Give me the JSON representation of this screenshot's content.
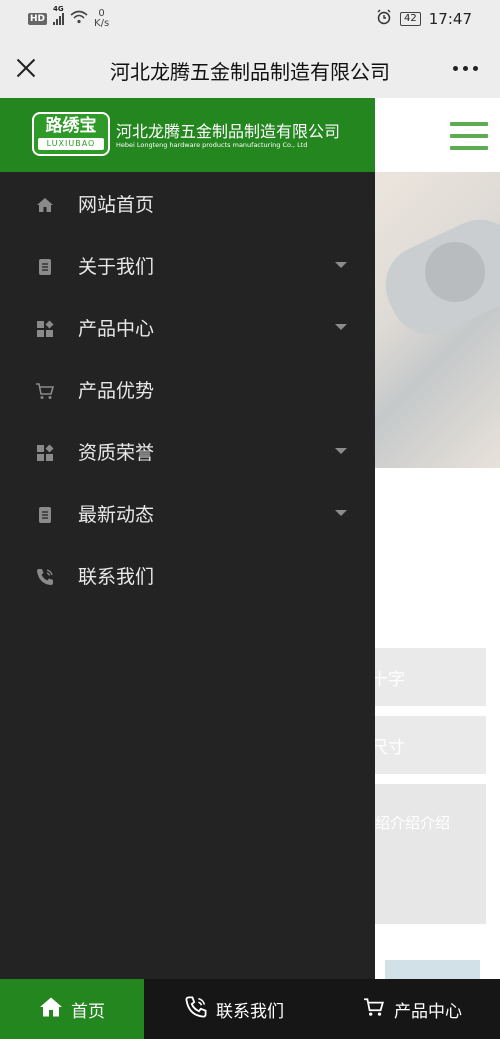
{
  "status_bar": {
    "left_badge": "HD",
    "network": "4G",
    "net_speed_value": "0",
    "net_speed_unit": "K/s",
    "battery": "42",
    "time": "17:47"
  },
  "title_bar": {
    "title": "河北龙腾五金制品制造有限公司",
    "close_icon": "close-icon",
    "more_icon": "more-icon"
  },
  "drawer": {
    "logo_cn": "路绣宝",
    "logo_en": "LUXIUBAO",
    "brand_cn": "河北龙腾五金制品制造有限公司",
    "brand_en": "Hebei Longteng hardware products manufacturing Co., Ltd",
    "menu": [
      {
        "label": "网站首页",
        "icon": "home-icon",
        "has_submenu": false
      },
      {
        "label": "关于我们",
        "icon": "document-icon",
        "has_submenu": true
      },
      {
        "label": "产品中心",
        "icon": "grid-icon",
        "has_submenu": true
      },
      {
        "label": "产品优势",
        "icon": "cart-icon",
        "has_submenu": false
      },
      {
        "label": "资质荣誉",
        "icon": "grid-icon",
        "has_submenu": true
      },
      {
        "label": "最新动态",
        "icon": "document-icon",
        "has_submenu": true
      },
      {
        "label": "联系我们",
        "icon": "phone-icon",
        "has_submenu": false
      }
    ]
  },
  "background_page": {
    "btn1_partial": "十字",
    "btn2_partial": "尺寸",
    "card_partial": "绍介绍介绍"
  },
  "bottom_nav": {
    "home": "首页",
    "contact": "联系我们",
    "products": "产品中心"
  },
  "colors": {
    "brand_green": "#23861f",
    "drawer_bg": "#232323",
    "bar_bg": "#ededed"
  }
}
